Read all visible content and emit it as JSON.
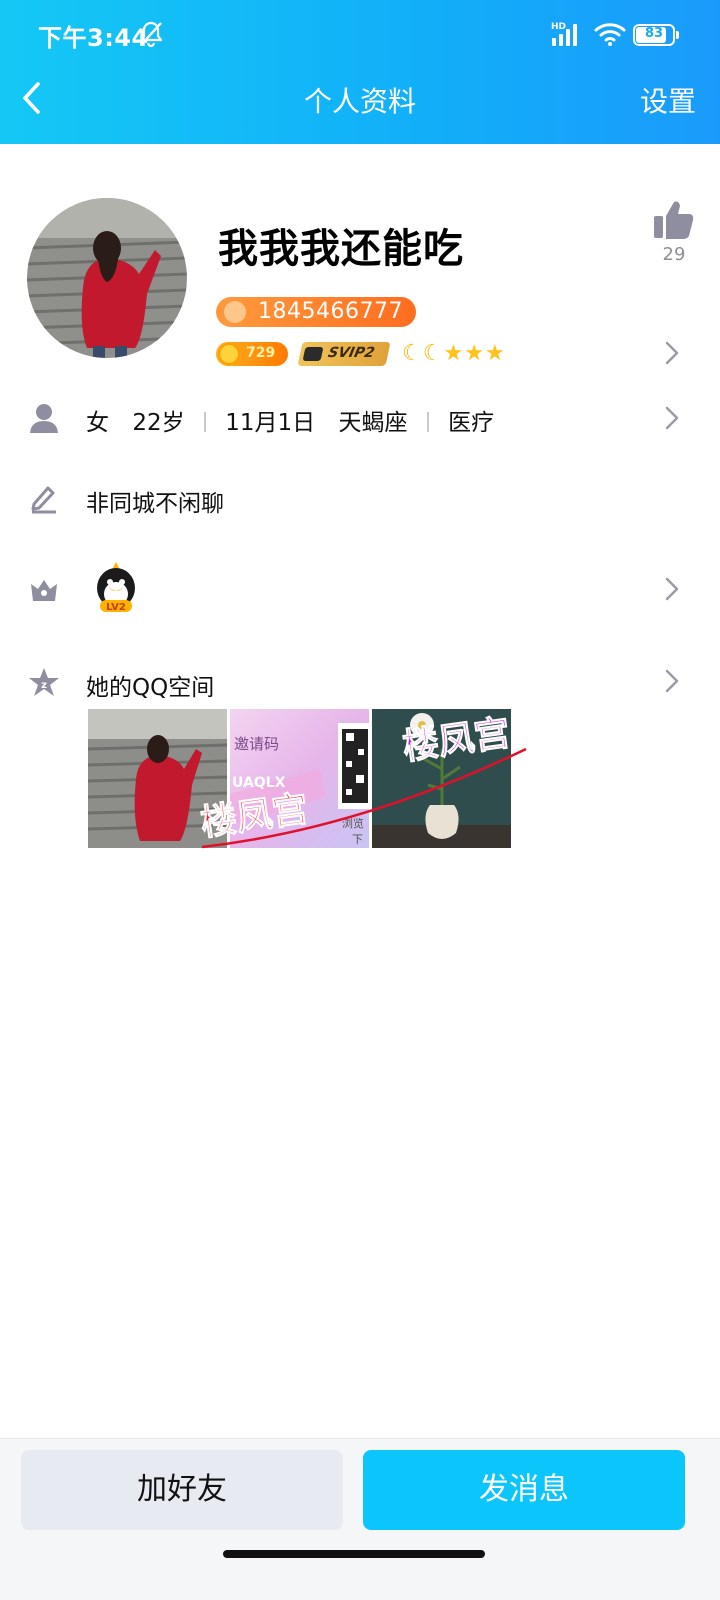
{
  "status_bar": {
    "time": "下午3:44",
    "network": "HD",
    "battery": "83"
  },
  "nav": {
    "title": "个人资料",
    "settings": "设置"
  },
  "profile": {
    "nickname": "我我我还能吃",
    "qq_number": "1845466777",
    "likes": "29",
    "coin_level": "729",
    "svip": "SVIP2",
    "level_icons": [
      "moon",
      "moon",
      "star",
      "star",
      "star"
    ]
  },
  "info": {
    "gender": "女",
    "age": "22岁",
    "birthday": "11月1日",
    "zodiac": "天蝎座",
    "industry": "医疗",
    "signature": "非同城不闲聊",
    "qzone_label": "她的QQ空间"
  },
  "qzone": {
    "thumb2_text_invite": "邀请码",
    "thumb2_text_code": "UAQLX",
    "thumb2_text_browse": "浏览",
    "thumb2_text_down": "下",
    "watermark": "楼凤宫"
  },
  "actions": {
    "add_friend": "加好友",
    "send_message": "发消息"
  },
  "colors": {
    "header_start": "#14c8f5",
    "header_end": "#1a9bfb",
    "primary_button": "#0cc6fb",
    "qq_pill": "#ff6d1f"
  }
}
